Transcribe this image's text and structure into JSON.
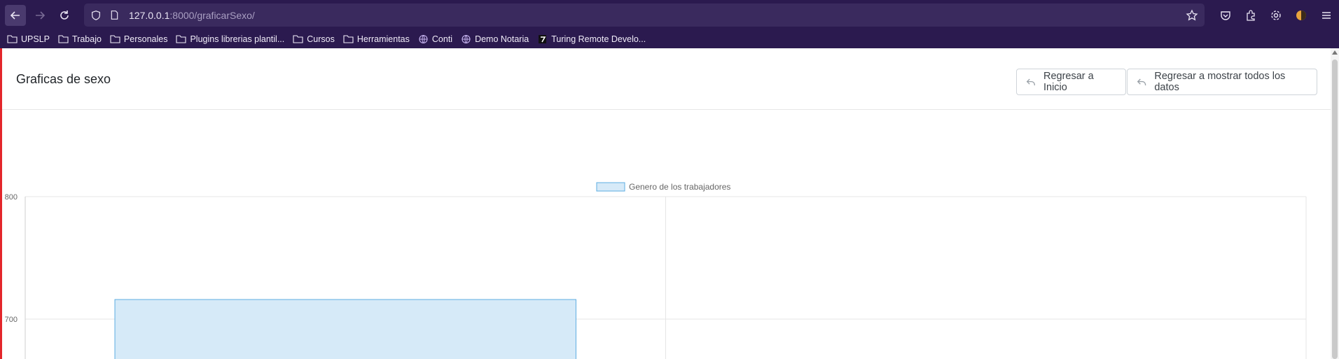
{
  "browser": {
    "url_host": "127.0.0.1",
    "url_path": ":8000/graficarSexo/",
    "bookmarks": [
      {
        "label": "UPSLP",
        "icon": "folder-icon"
      },
      {
        "label": "Trabajo",
        "icon": "folder-icon"
      },
      {
        "label": "Personales",
        "icon": "folder-icon"
      },
      {
        "label": "Plugins librerias plantil...",
        "icon": "folder-icon"
      },
      {
        "label": "Cursos",
        "icon": "folder-icon"
      },
      {
        "label": "Herramientas",
        "icon": "folder-icon"
      },
      {
        "label": "Conti",
        "icon": "globe-icon"
      },
      {
        "label": "Demo Notaria",
        "icon": "globe-icon"
      },
      {
        "label": "Turing Remote Develo...",
        "icon": "turing-icon"
      }
    ]
  },
  "header": {
    "title": "Graficas de sexo",
    "btn_inicio": "Regresar a Inicio",
    "btn_todos": "Regresar a mostrar todos los datos"
  },
  "chart_data": {
    "type": "bar",
    "series": [
      {
        "name": "Genero de los trabajadores",
        "values": [
          716,
          null
        ],
        "color": "#d6eaf8",
        "border": "#5dade2"
      }
    ],
    "categories": [
      "",
      ""
    ],
    "y_ticks": [
      800,
      700
    ],
    "ylim_visible": [
      612,
      800
    ],
    "grid": true,
    "legend": "top-center"
  }
}
